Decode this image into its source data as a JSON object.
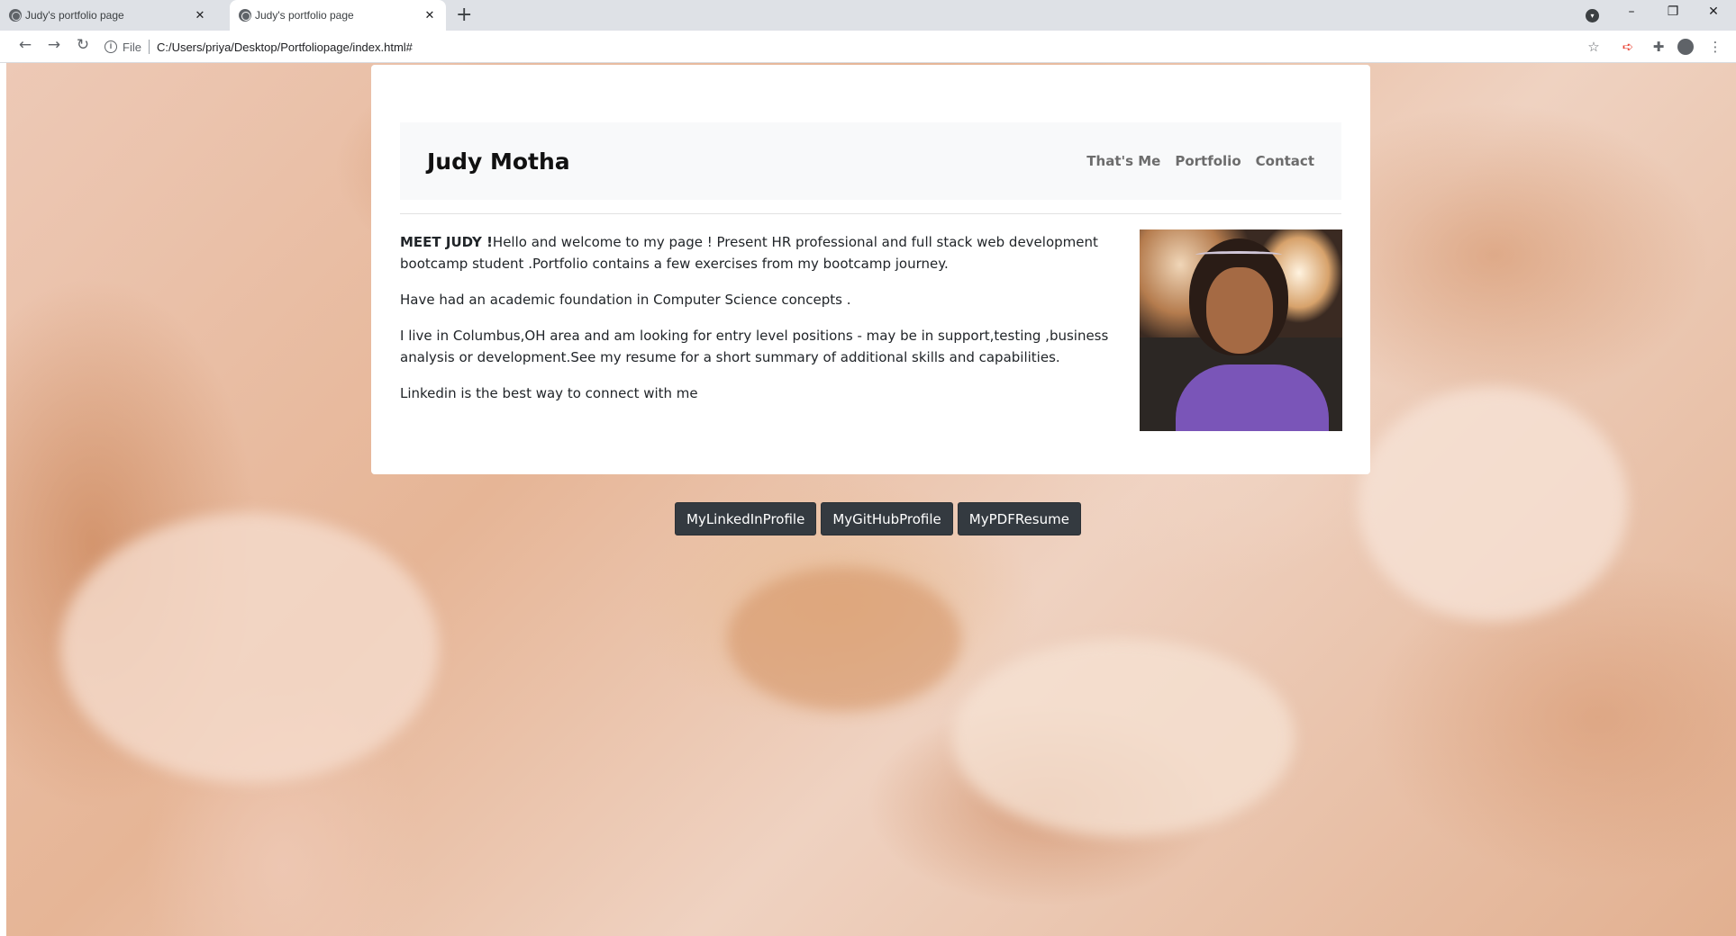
{
  "browser": {
    "tabs": [
      {
        "title": "Judy's portfolio page",
        "close": "✕",
        "active": false
      },
      {
        "title": "Judy's portfolio page",
        "close": "✕",
        "active": true
      }
    ],
    "new_tab": "+",
    "window_controls": {
      "minimize": "–",
      "restore": "❐",
      "close": "✕"
    },
    "nav": {
      "back": "←",
      "forward": "→",
      "reload": "↻"
    },
    "address": {
      "info": "i",
      "scheme": "File",
      "url": "C:/Users/priya/Desktop/Portfoliopage/index.html#"
    },
    "toolbar_icons": {
      "star": "☆",
      "extension_red": "➪",
      "puzzle": "✚",
      "menu": "⋮"
    }
  },
  "page": {
    "brand": "Judy Motha",
    "nav_links": [
      "That's Me",
      "Portfolio",
      "Contact"
    ],
    "intro_bold": "MEET JUDY !",
    "paragraphs": [
      "Hello and welcome to my page ! Present HR professional and full stack web development bootcamp student .Portfolio contains a few exercises from my bootcamp journey.",
      "Have had an academic foundation in Computer Science concepts .",
      "I live in Columbus,OH area and am looking for entry level positions - may be in support,testing ,business analysis or development.See my resume for a short summary of additional skills and capabilities.",
      "Linkedin is the best way to connect with me"
    ],
    "buttons": [
      "MyLinkedInProfile",
      "MyGitHubProfile",
      "MyPDFResume"
    ]
  },
  "colors": {
    "button_bg": "#343a40",
    "navbar_bg": "#f8f9fa",
    "background_marble": "#e6b596"
  }
}
